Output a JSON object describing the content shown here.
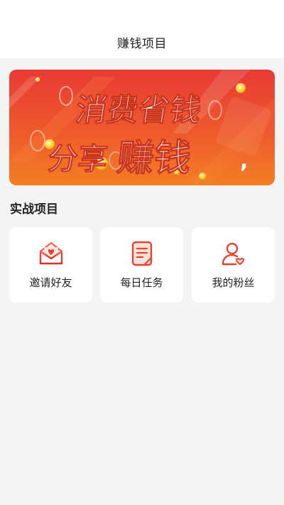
{
  "header": {
    "title": "赚钱项目"
  },
  "banner": {
    "line1": "消费省钱",
    "line2_part1": "分享",
    "line2_part2": "赚钱",
    "line2_suffix": ","
  },
  "section": {
    "title": "实战项目"
  },
  "cards": [
    {
      "label": "邀请好友",
      "icon": "invite-envelope-heart-icon"
    },
    {
      "label": "每日任务",
      "icon": "daily-task-document-icon"
    },
    {
      "label": "我的粉丝",
      "icon": "fans-user-heart-icon"
    }
  ],
  "colors": {
    "icon_red": "#e3432f",
    "banner_red": "#e83a34",
    "banner_orange": "#f47f24",
    "page_bg": "#f4f4f4"
  }
}
